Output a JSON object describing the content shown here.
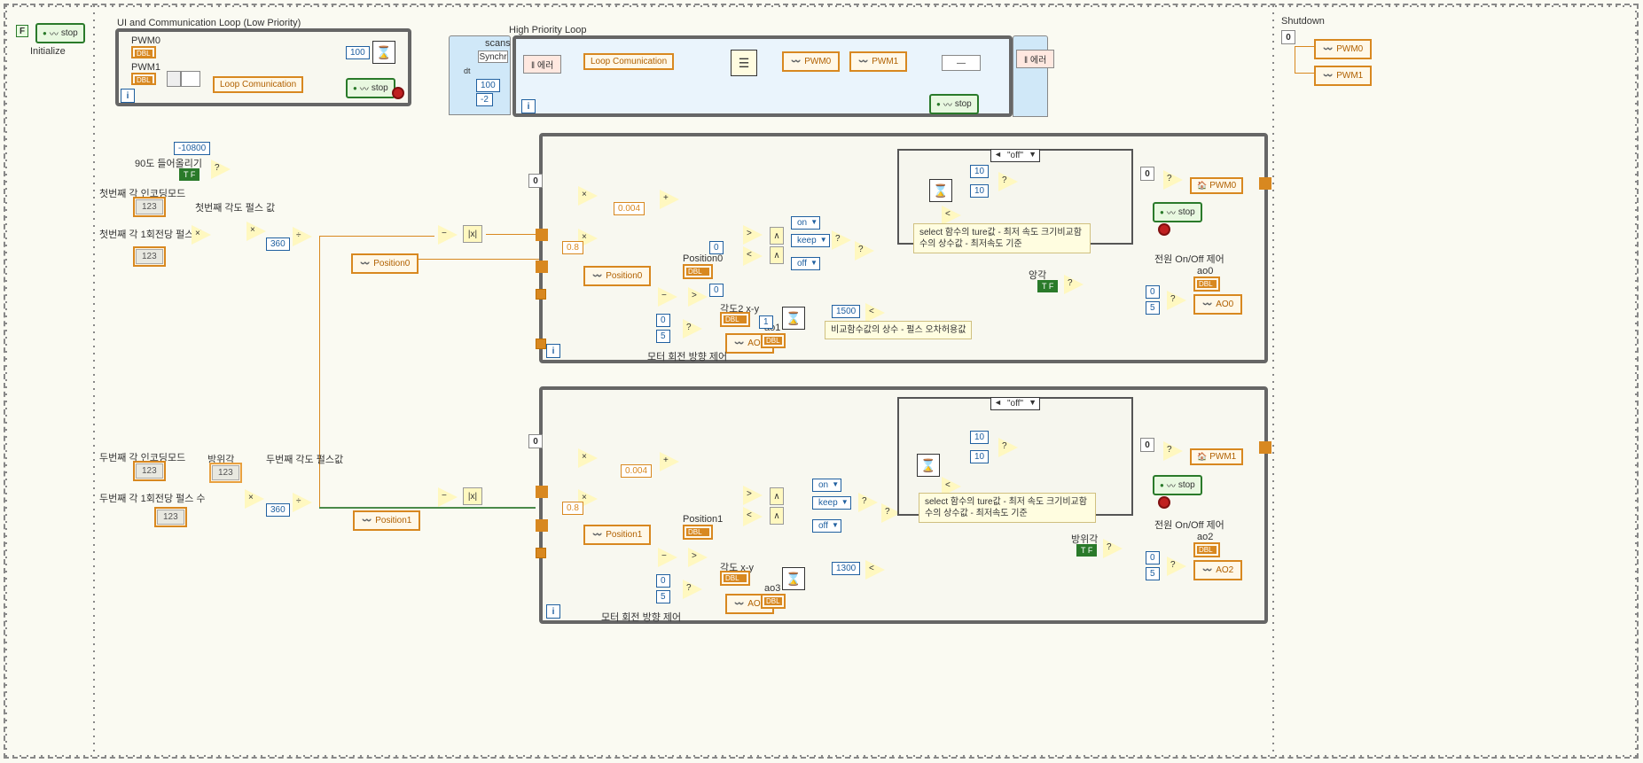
{
  "state_labels": {
    "init": "Initialize",
    "shutdown": "Shutdown"
  },
  "loops": {
    "ui_loop_label": "UI and Communication Loop (Low Priority)",
    "hp_loop_label": "High Priority Loop"
  },
  "buttons": {
    "stop": "stop"
  },
  "vi_refs": {
    "loop_comm": "Loop Comunication"
  },
  "fpga": {
    "pwm0": "PWM0",
    "pwm1": "PWM1",
    "pos0": "Position0",
    "pos1": "Position1",
    "ao0": "AO0",
    "ao1": "AO1",
    "ao2": "AO2",
    "ao3": "AO3"
  },
  "consts": {
    "neg10800": "-10800",
    "c100": "100",
    "c360_a": "360",
    "c360_b": "360",
    "c0_004_a": "0.004",
    "c0_004_b": "0.004",
    "c0_8_a": "0.8",
    "c0_8_b": "0.8",
    "c0_a": "0",
    "c5_a": "5",
    "c0_b": "0",
    "c5_b": "5",
    "c0_c": "0",
    "c5_c": "5",
    "c0_d": "0",
    "c5_d": "5",
    "c10_a1": "10",
    "c10_a2": "10",
    "c10_b1": "10",
    "c10_b2": "10",
    "c1500": "1500",
    "c1300": "1300",
    "c0_z1": "0",
    "c0_z2": "0",
    "c1": "1",
    "dt_100": "100",
    "dt_neg2": "-2"
  },
  "labels": {
    "l_90lift": "90도 들어올리기",
    "l_enc_mode1": "첫번째 각 인코딩모드",
    "l_ppr1": "첫번째 각 1회전당 펄스 수",
    "l_pulse_val1": "첫번째 각도 펄스 값",
    "l_enc_mode2": "두번째 각 인코딩모드",
    "l_azimuth": "방위각",
    "l_ppr2": "두번째 각 1회전당 펄스 수",
    "l_pulse_val2": "두번째 각도 펄스값",
    "l_pos0_ind": "Position0",
    "l_pos1_ind": "Position1",
    "l_angle2xy": "각도2 x-y",
    "l_anglexy": "각도 x-y",
    "l_ao1": "ao1",
    "l_ao3": "ao3",
    "l_motor_dir1": "모터 회전 방향 제어",
    "l_motor_dir2": "모터 회전 방향 제어",
    "l_cmp_const1": "비교함수값의 상수\n- 펄스 오차허용값",
    "l_select_note1": "select 함수의 ture값 - 최저 속도\n크기비교함수의 상수값 - 최저속도 기준",
    "l_select_note2": "select 함수의 ture값 - 최저 속도\n크기비교함수의 상수값 - 최저속도 기준",
    "l_elev": "앙각",
    "l_azi_ind": "방위각",
    "l_pwr_onoff1": "전원 On/Off 제어",
    "l_pwr_onoff2": "전원 On/Off 제어",
    "l_ao0": "ao0",
    "l_ao2": "ao2",
    "l_scans": "scans",
    "l_synchr": "Synchr",
    "l_dt": "dt"
  },
  "rings": {
    "on": "on",
    "keep": "keep",
    "off": "off",
    "case_off1": "\"off\"",
    "case_off2": "\"off\""
  },
  "err": {
    "label": "에러"
  },
  "idx": {
    "i": "i",
    "zero": "0",
    "seq_f": "F"
  },
  "dtype": {
    "dbl": "DBL",
    "i32": "123"
  }
}
